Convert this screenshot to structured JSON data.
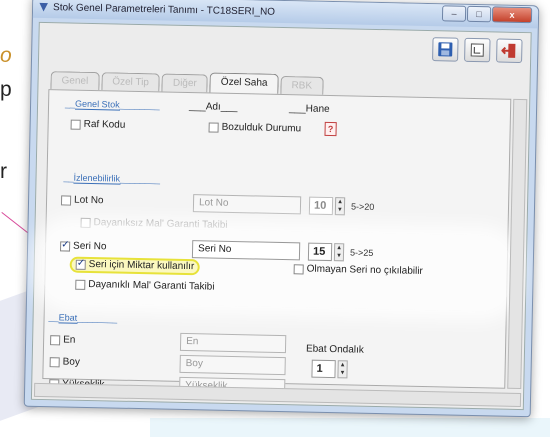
{
  "window": {
    "title": "Stok Genel Parametreleri Tanımı - TC18SERI_NO",
    "minimize_label": "–",
    "maximize_label": "□",
    "close_label": "x"
  },
  "background": {
    "frag_o": "o",
    "frag_p": "p",
    "frag_r": "r"
  },
  "tabs": [
    {
      "label": "Genel"
    },
    {
      "label": "Özel Tip"
    },
    {
      "label": "Diğer"
    },
    {
      "label": "Özel Saha"
    },
    {
      "label": "RBK"
    }
  ],
  "genel_stok": {
    "section": "Genel Stok",
    "col_adi": "Adı",
    "col_hane": "Hane",
    "raf_kodu": "Raf Kodu",
    "bozulduk": "Bozulduk Durumu"
  },
  "izlenebilirlik": {
    "section": "İzlenebilirlik",
    "lot_no": {
      "label": "Lot No",
      "field": "Lot No",
      "value": "10",
      "range": "5->20",
      "checked": false
    },
    "dayaniksiz": "Dayanıksız Mal' Garanti Takibi",
    "seri_no": {
      "label": "Seri No",
      "field": "Seri No",
      "value": "15",
      "range": "5->25",
      "checked": true
    },
    "seri_miktar": {
      "label": "Seri için Miktar kullanılır",
      "checked": true
    },
    "olmayan": "Olmayan Seri no çıkılabilir",
    "dayanikli": "Dayanıklı Mal' Garanti Takibi"
  },
  "ebat": {
    "section": "Ebat",
    "en": {
      "label": "En",
      "field": "En"
    },
    "boy": {
      "label": "Boy",
      "field": "Boy"
    },
    "yukseklik": {
      "label": "Yükseklik",
      "field": "Yükseklik"
    },
    "ondalik_label": "Ebat Ondalık",
    "ondalik_value": "1"
  },
  "colors": {
    "highlight": "#e7e23a",
    "section": "#3a6fb8",
    "pointer": "#d84a9a"
  }
}
